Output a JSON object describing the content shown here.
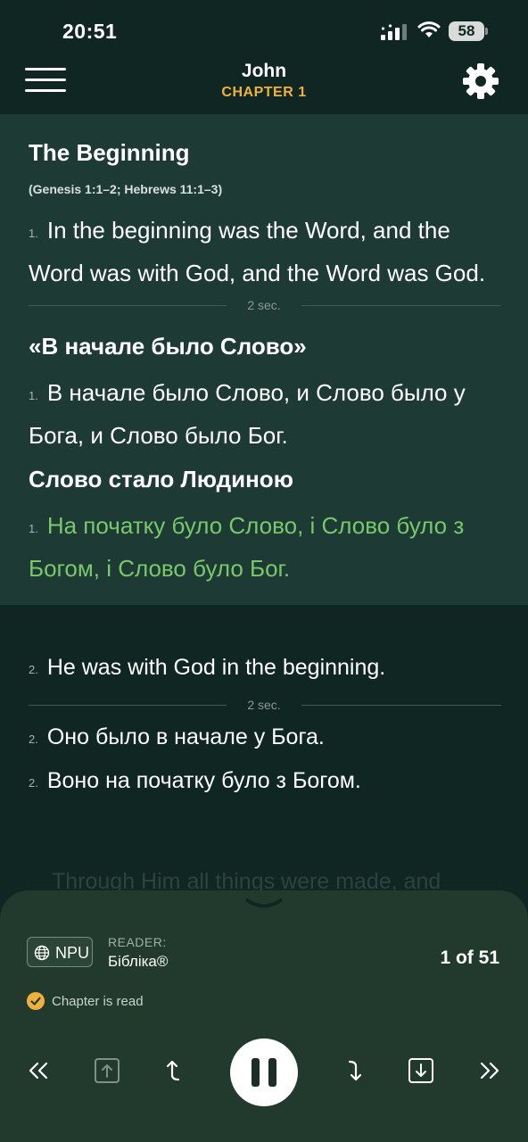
{
  "status_bar": {
    "time": "20:51",
    "battery": "58"
  },
  "header": {
    "title": "John",
    "subtitle": "CHAPTER 1"
  },
  "block1": {
    "title_en": "The Beginning",
    "refs": "(Genesis 1:1–2; Hebrews 11:1–3)",
    "verse_en_num": "1.",
    "verse_en_line1": "In the beginning was the Word, and the",
    "verse_en_line2": "Word was with God, and the Word was God.",
    "pause_label": "2 sec.",
    "title_ru": "«В начале было Слово»",
    "verse_ru_num": "1.",
    "verse_ru_line1": "В начале было Слово, и Слово было у",
    "verse_ru_line2": "Бога, и Слово было Бог.",
    "title_uk": "Слово стало Людиною",
    "verse_uk_num": "1.",
    "verse_uk_line1": "На початку було Слово, і Слово було з",
    "verse_uk_line2": "Богом, і Слово було Бог."
  },
  "block2": {
    "verse_en_num": "2.",
    "verse_en": "He was with God in the beginning.",
    "pause_label": "2 sec.",
    "verse_ru_num": "2.",
    "verse_ru": "Оно было в начале у Бога.",
    "verse_uk_num": "2.",
    "verse_uk": "Воно на початку було з Богом."
  },
  "next_verse_preview": "Through Him all things were made, and",
  "player": {
    "translation_badge": "NPU",
    "reader_label": "READER:",
    "reader_name": "Бібліка®",
    "counter": "1 of 51",
    "status": "Chapter is read"
  },
  "colors": {
    "background": "#0f2623",
    "active_block": "#1d3a35",
    "player": "#213a2d",
    "accent": "#f0b13c",
    "highlight_verse": "#79c96a"
  },
  "icons": [
    "menu-icon",
    "gear-icon",
    "globe-icon",
    "check-circle-icon",
    "rewind-icon",
    "bookmark-up-icon",
    "arrow-up-icon",
    "pause-icon",
    "arrow-down-icon",
    "bookmark-down-icon",
    "fast-forward-icon",
    "chevron-down-icon"
  ]
}
